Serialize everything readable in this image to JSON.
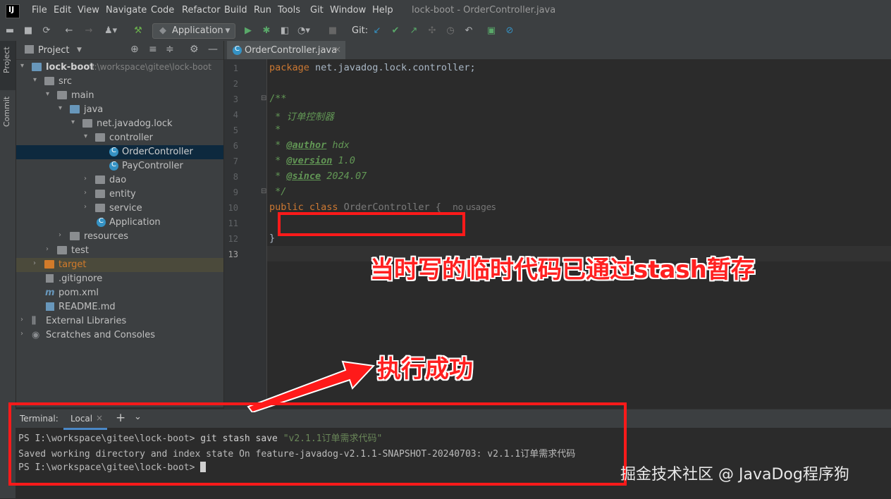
{
  "menubar": {
    "logo": "IJ",
    "items": [
      "File",
      "Edit",
      "View",
      "Navigate",
      "Code",
      "Refactor",
      "Build",
      "Run",
      "Tools",
      "Git",
      "Window",
      "Help"
    ],
    "title": "lock-boot - OrderController.java"
  },
  "toolbar": {
    "run_config": "Application",
    "git_label": "Git:"
  },
  "left_stripe": {
    "project_tab": "Project",
    "commit_tab": "Commit"
  },
  "project": {
    "title": "Project",
    "tree": [
      {
        "label": "lock-boot",
        "extra": "I:\\workspace\\gitee\\lock-boot"
      },
      {
        "label": "src"
      },
      {
        "label": "main"
      },
      {
        "label": "java"
      },
      {
        "label": "net.javadog.lock"
      },
      {
        "label": "controller"
      },
      {
        "label": "OrderController"
      },
      {
        "label": "PayController"
      },
      {
        "label": "dao"
      },
      {
        "label": "entity"
      },
      {
        "label": "service"
      },
      {
        "label": "Application"
      },
      {
        "label": "resources"
      },
      {
        "label": "test"
      },
      {
        "label": "target"
      },
      {
        "label": ".gitignore"
      },
      {
        "label": "pom.xml"
      },
      {
        "label": "README.md"
      },
      {
        "label": "External Libraries"
      },
      {
        "label": "Scratches and Consoles"
      }
    ]
  },
  "editor": {
    "tab": "OrderController.java",
    "line_numbers": [
      "1",
      "2",
      "3",
      "4",
      "5",
      "6",
      "7",
      "8",
      "9",
      "10",
      "11",
      "12",
      "13"
    ],
    "code": {
      "l1_kw": "package",
      "l1_rest": " net.javadog.lock.controller;",
      "l3": "/**",
      "l4": " * 订单控制器",
      "l5": " *",
      "l6_pre": " * ",
      "l6_tag": "@author",
      "l6_val": " hdx",
      "l7_pre": " * ",
      "l7_tag": "@version",
      "l7_val": " 1.0",
      "l8_pre": " * ",
      "l8_tag": "@since",
      "l8_val": " 2024.07",
      "l9": " */",
      "l10_kw": "public class",
      "l10_name": " OrderController {",
      "l10_usages": "no usages",
      "l12": "}"
    }
  },
  "terminal": {
    "title": "Terminal:",
    "tab": "Local",
    "lines": {
      "l1_prompt": "PS I:\\workspace\\gitee\\lock-boot> ",
      "l1_cmd": "git stash save ",
      "l1_str": "\"v2.1.1订单需求代码\"",
      "l2": "Saved working directory and index state On feature-javadog-v2.1.1-SNAPSHOT-20240703: v2.1.1订单需求代码",
      "l3_prompt": "PS I:\\workspace\\gitee\\lock-boot> "
    }
  },
  "annotations": {
    "stash_note": "当时写的临时代码已通过stash暂存",
    "success_note": "执行成功",
    "watermark": "掘金技术社区 @ JavaDog程序狗"
  },
  "colors": {
    "accent": "#4a88c7",
    "annotation_red": "#ff1a1a",
    "keyword": "#cc7832",
    "comment": "#629755"
  }
}
